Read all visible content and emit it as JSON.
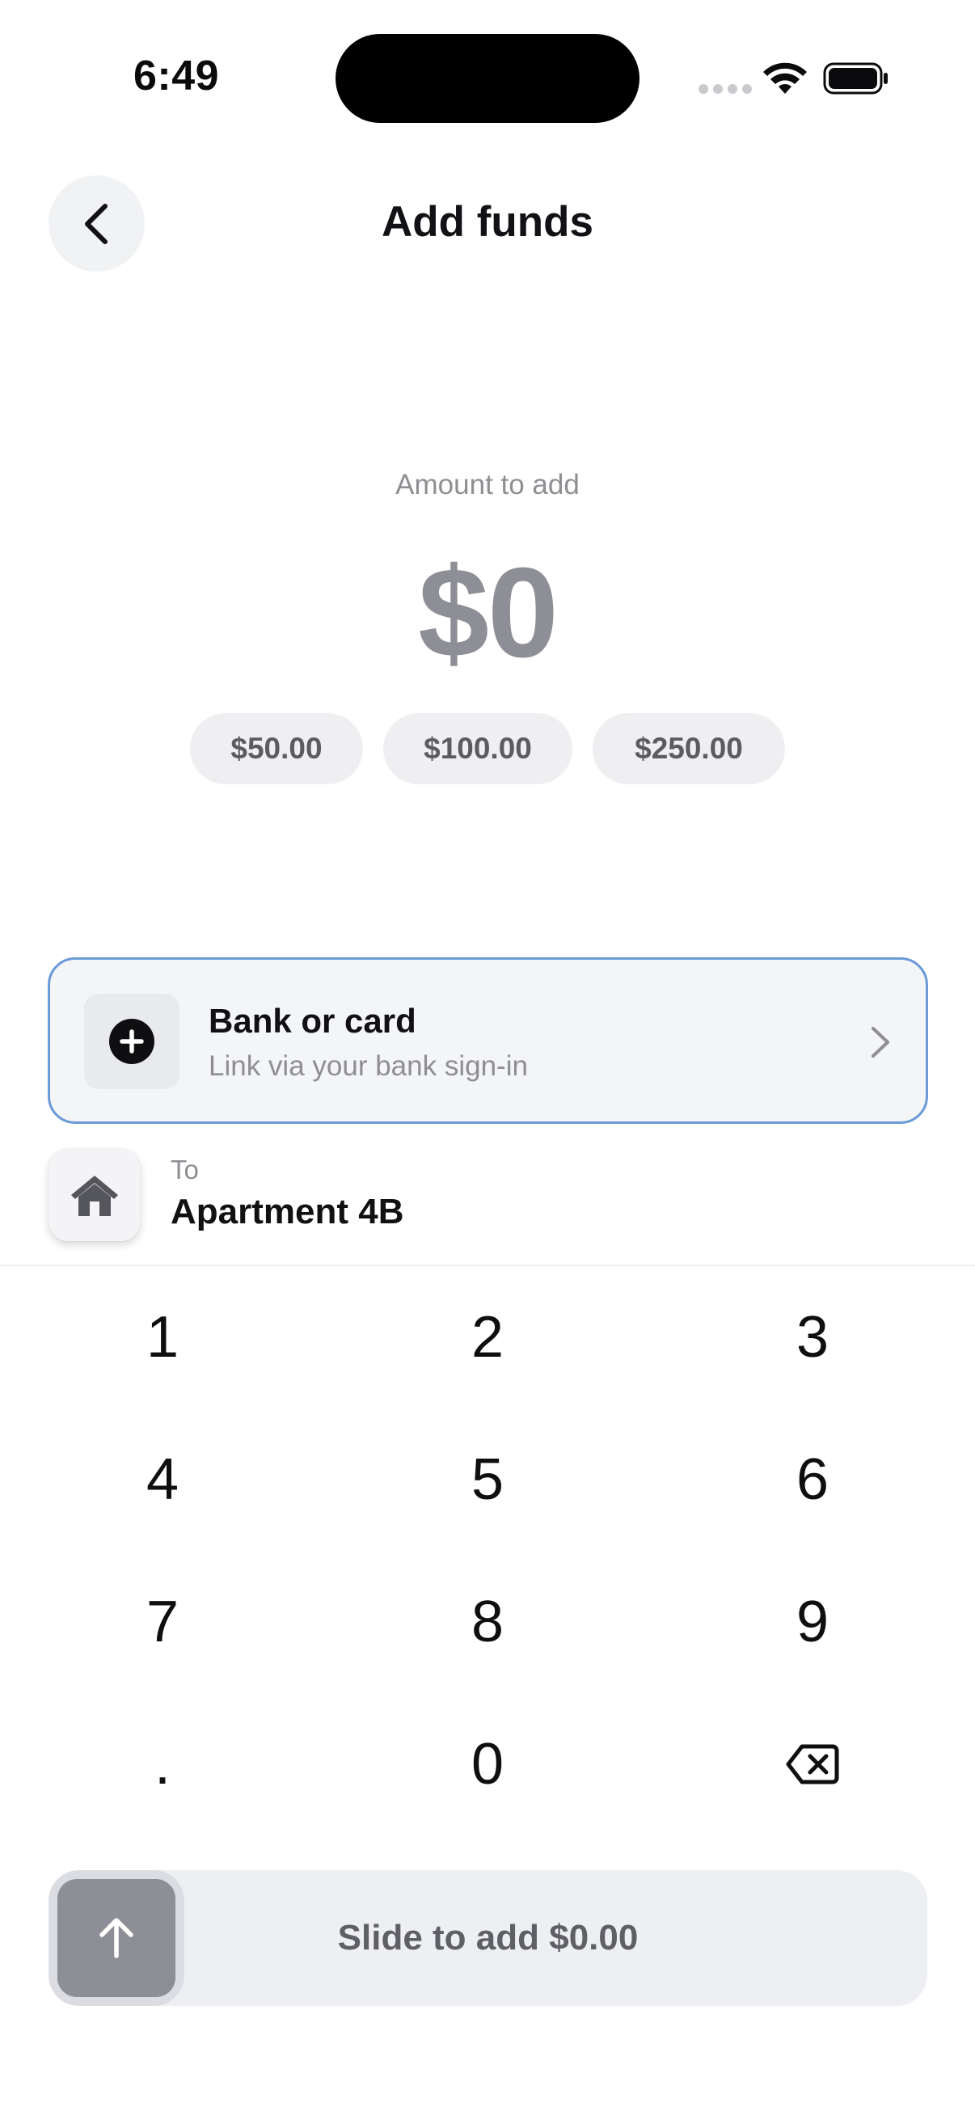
{
  "status_bar": {
    "time": "6:49"
  },
  "header": {
    "title": "Add funds",
    "back_icon": "chevron-left-icon"
  },
  "amount": {
    "label": "Amount to add",
    "value": "$0"
  },
  "presets": [
    {
      "label": "$50.00"
    },
    {
      "label": "$100.00"
    },
    {
      "label": "$250.00"
    }
  ],
  "source": {
    "title": "Bank or card",
    "subtitle": "Link via your bank sign-in",
    "icon": "plus-circle-icon",
    "accent_color": "#6a9ad8"
  },
  "destination": {
    "label": "To",
    "value": "Apartment 4B",
    "icon": "house-icon"
  },
  "keypad": {
    "keys": [
      "1",
      "2",
      "3",
      "4",
      "5",
      "6",
      "7",
      "8",
      "9",
      ".",
      "0",
      "backspace-icon"
    ]
  },
  "slider": {
    "label": "Slide to add $0.00",
    "icon": "arrow-up-icon"
  }
}
